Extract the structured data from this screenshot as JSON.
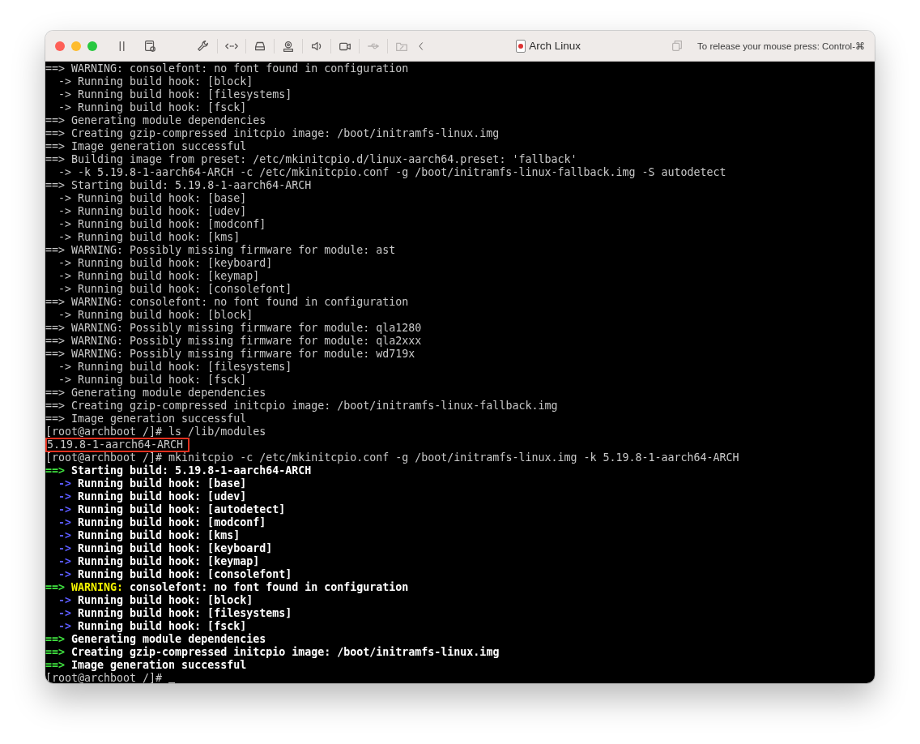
{
  "window": {
    "title": "Arch Linux",
    "hint": "To release your mouse press: Control-⌘"
  },
  "terminal": {
    "lines": [
      {
        "kind": "plain",
        "text": "==> WARNING: consolefont: no font found in configuration"
      },
      {
        "kind": "plain_indent",
        "text": "-> Running build hook: [block]"
      },
      {
        "kind": "plain_indent",
        "text": "-> Running build hook: [filesystems]"
      },
      {
        "kind": "plain_indent",
        "text": "-> Running build hook: [fsck]"
      },
      {
        "kind": "plain",
        "text": "==> Generating module dependencies"
      },
      {
        "kind": "plain",
        "text": "==> Creating gzip-compressed initcpio image: /boot/initramfs-linux.img"
      },
      {
        "kind": "plain",
        "text": "==> Image generation successful"
      },
      {
        "kind": "plain",
        "text": "==> Building image from preset: /etc/mkinitcpio.d/linux-aarch64.preset: 'fallback'"
      },
      {
        "kind": "plain_indent",
        "text": "-> -k 5.19.8-1-aarch64-ARCH -c /etc/mkinitcpio.conf -g /boot/initramfs-linux-fallback.img -S autodetect"
      },
      {
        "kind": "plain",
        "text": "==> Starting build: 5.19.8-1-aarch64-ARCH"
      },
      {
        "kind": "plain_indent",
        "text": "-> Running build hook: [base]"
      },
      {
        "kind": "plain_indent",
        "text": "-> Running build hook: [udev]"
      },
      {
        "kind": "plain_indent",
        "text": "-> Running build hook: [modconf]"
      },
      {
        "kind": "plain_indent",
        "text": "-> Running build hook: [kms]"
      },
      {
        "kind": "plain",
        "text": "==> WARNING: Possibly missing firmware for module: ast"
      },
      {
        "kind": "plain_indent",
        "text": "-> Running build hook: [keyboard]"
      },
      {
        "kind": "plain_indent",
        "text": "-> Running build hook: [keymap]"
      },
      {
        "kind": "plain_indent",
        "text": "-> Running build hook: [consolefont]"
      },
      {
        "kind": "plain",
        "text": "==> WARNING: consolefont: no font found in configuration"
      },
      {
        "kind": "plain_indent",
        "text": "-> Running build hook: [block]"
      },
      {
        "kind": "plain",
        "text": "==> WARNING: Possibly missing firmware for module: qla1280"
      },
      {
        "kind": "plain",
        "text": "==> WARNING: Possibly missing firmware for module: qla2xxx"
      },
      {
        "kind": "plain",
        "text": "==> WARNING: Possibly missing firmware for module: wd719x"
      },
      {
        "kind": "plain_indent",
        "text": "-> Running build hook: [filesystems]"
      },
      {
        "kind": "plain_indent",
        "text": "-> Running build hook: [fsck]"
      },
      {
        "kind": "plain",
        "text": "==> Generating module dependencies"
      },
      {
        "kind": "plain",
        "text": "==> Creating gzip-compressed initcpio image: /boot/initramfs-linux-fallback.img"
      },
      {
        "kind": "plain",
        "text": "==> Image generation successful"
      },
      {
        "kind": "plain",
        "text": "[root@archboot /]# ls /lib/modules"
      },
      {
        "kind": "boxed",
        "text": "5.19.8-1-aarch64-ARCH"
      },
      {
        "kind": "plain",
        "text": "[root@archboot /]# mkinitcpio -c /etc/mkinitcpio.conf -g /boot/initramfs-linux.img -k 5.19.8-1-aarch64-ARCH"
      },
      {
        "kind": "green",
        "prefix": "==>",
        "text": "Starting build: 5.19.8-1-aarch64-ARCH"
      },
      {
        "kind": "blue",
        "prefix": "->",
        "text": "Running build hook: [base]"
      },
      {
        "kind": "blue",
        "prefix": "->",
        "text": "Running build hook: [udev]"
      },
      {
        "kind": "blue",
        "prefix": "->",
        "text": "Running build hook: [autodetect]"
      },
      {
        "kind": "blue",
        "prefix": "->",
        "text": "Running build hook: [modconf]"
      },
      {
        "kind": "blue",
        "prefix": "->",
        "text": "Running build hook: [kms]"
      },
      {
        "kind": "blue",
        "prefix": "->",
        "text": "Running build hook: [keyboard]"
      },
      {
        "kind": "blue",
        "prefix": "->",
        "text": "Running build hook: [keymap]"
      },
      {
        "kind": "blue",
        "prefix": "->",
        "text": "Running build hook: [consolefont]"
      },
      {
        "kind": "warning",
        "prefix": "==>",
        "label": "WARNING:",
        "text": "consolefont: no font found in configuration"
      },
      {
        "kind": "blue",
        "prefix": "->",
        "text": "Running build hook: [block]"
      },
      {
        "kind": "blue",
        "prefix": "->",
        "text": "Running build hook: [filesystems]"
      },
      {
        "kind": "blue",
        "prefix": "->",
        "text": "Running build hook: [fsck]"
      },
      {
        "kind": "green",
        "prefix": "==>",
        "text": "Generating module dependencies"
      },
      {
        "kind": "green",
        "prefix": "==>",
        "text": "Creating gzip-compressed initcpio image: /boot/initramfs-linux.img"
      },
      {
        "kind": "green",
        "prefix": "==>",
        "text": "Image generation successful"
      },
      {
        "kind": "prompt_cursor",
        "text": "[root@archboot /]#"
      }
    ]
  }
}
